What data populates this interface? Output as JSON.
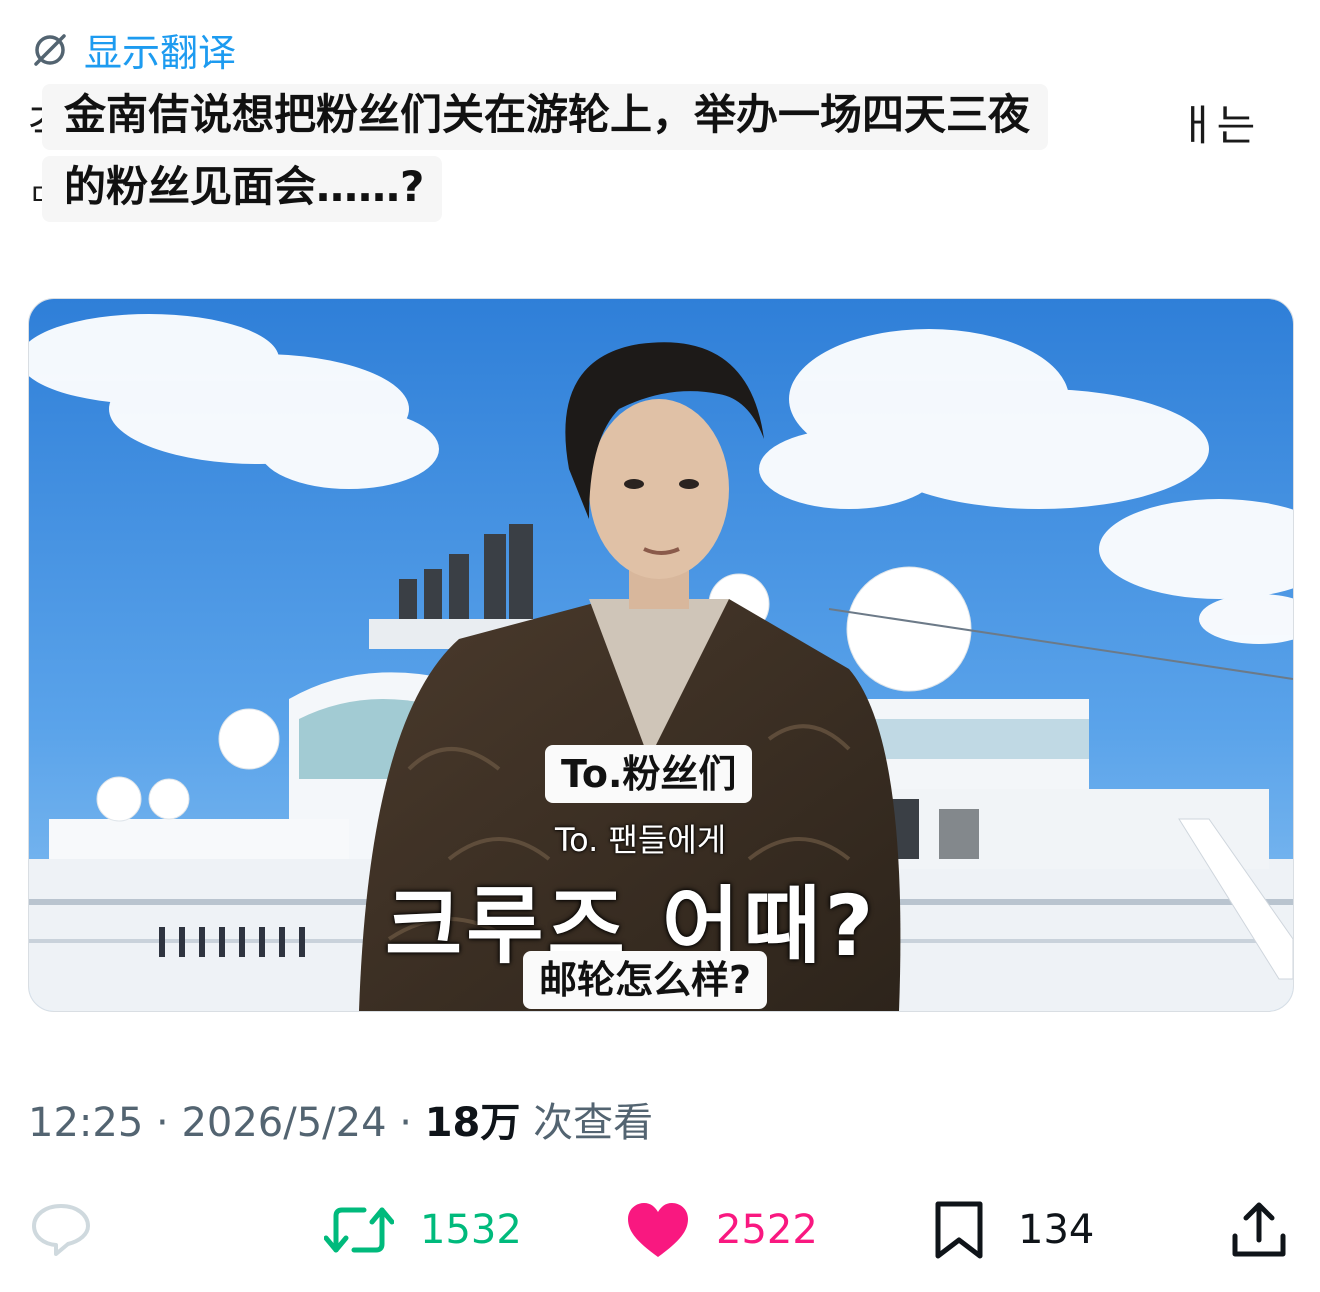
{
  "translate": {
    "label": "显示翻译",
    "icon": "globe-slash-icon"
  },
  "tweet": {
    "line1": "金南佶说想把粉丝们关在游轮上，举办一场四天三夜",
    "line2": "的粉丝见面会……?",
    "ghost_left_1": "각",
    "ghost_right_1": "ㅐ는",
    "ghost_left_2": "ㄷ"
  },
  "media": {
    "caption_cn_1": "To.粉丝们",
    "caption_ko_1": "To. 팬들에게",
    "caption_ko_2": "크루즈 어때?",
    "caption_cn_2": "邮轮怎么样?"
  },
  "meta": {
    "time": "12:25",
    "sep1": " · ",
    "date": "2026/5/24",
    "sep2": " · ",
    "views": "18万",
    "views_suffix": " 次查看"
  },
  "actions": {
    "reply": {
      "icon": "reply-icon",
      "count": ""
    },
    "retweet": {
      "icon": "retweet-icon",
      "count": "1532",
      "color": "#00ba7c"
    },
    "like": {
      "icon": "heart-icon",
      "count": "2522",
      "color": "#f91880"
    },
    "bookmark": {
      "icon": "bookmark-icon",
      "count": "134",
      "color": "#0f1419"
    },
    "share": {
      "icon": "share-icon"
    }
  }
}
